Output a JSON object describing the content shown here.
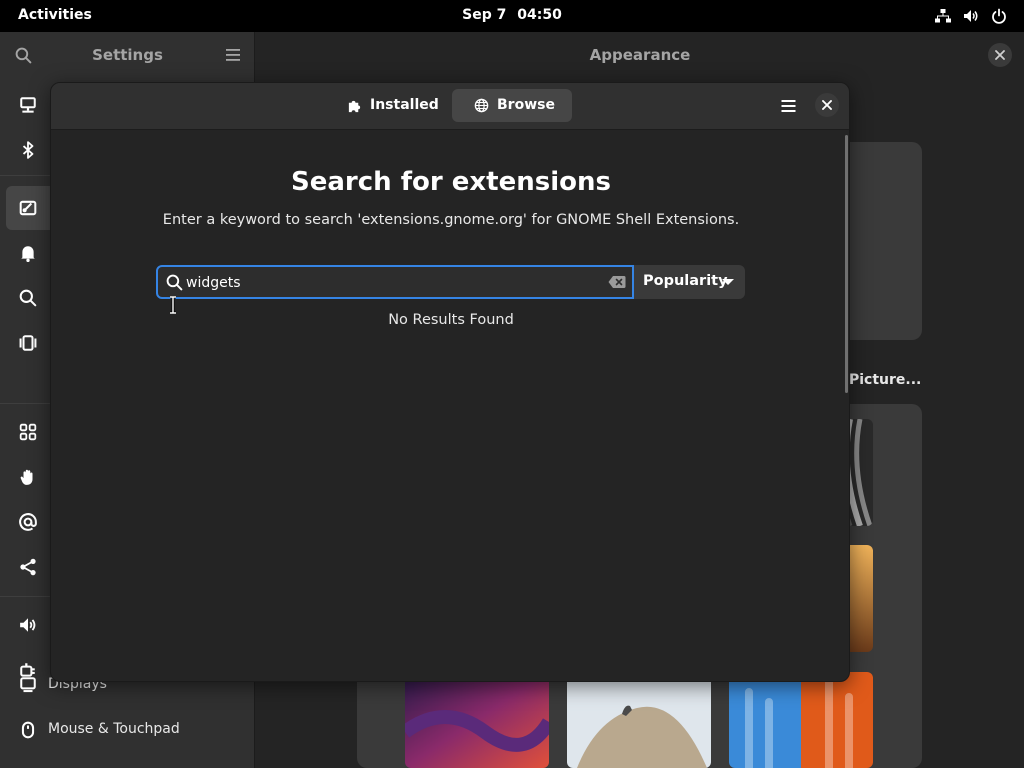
{
  "topbar": {
    "activities": "Activities",
    "date": "Sep 7",
    "time": "04:50",
    "tray_icons": [
      "network-icon",
      "volume-icon",
      "power-icon"
    ]
  },
  "settings": {
    "sidebar_title": "Settings",
    "main_title": "Appearance",
    "sidebar_items": [
      {
        "icon": "network-computer-icon",
        "label": ""
      },
      {
        "icon": "bluetooth-icon",
        "label": ""
      },
      {
        "icon": "appearance-icon",
        "label": "",
        "active": true
      },
      {
        "icon": "bell-icon",
        "label": ""
      },
      {
        "icon": "search-icon",
        "label": ""
      },
      {
        "icon": "multitasking-icon",
        "label": ""
      },
      {
        "icon": "apps-grid-icon",
        "label": ""
      },
      {
        "icon": "hand-icon",
        "label": ""
      },
      {
        "icon": "at-icon",
        "label": ""
      },
      {
        "icon": "share-icon",
        "label": ""
      },
      {
        "icon": "sound-icon",
        "label": ""
      },
      {
        "icon": "power-plug-icon",
        "label": ""
      },
      {
        "icon": "display-icon",
        "label": "Displays"
      },
      {
        "icon": "mouse-icon",
        "label": "Mouse & Touchpad"
      }
    ],
    "background_label": "Picture..."
  },
  "dialog": {
    "tabs": [
      {
        "label": "Installed",
        "icon": "puzzle-icon"
      },
      {
        "label": "Browse",
        "icon": "globe-icon",
        "selected": true
      }
    ],
    "title": "Search for extensions",
    "description": "Enter a keyword to search 'extensions.gnome.org' for GNOME Shell Extensions.",
    "search": {
      "value": "widgets",
      "placeholder": ""
    },
    "sort": {
      "selected": "Popularity"
    },
    "status": "No Results Found"
  },
  "colors": {
    "accent": "#3584e4",
    "window_bg": "#242424",
    "sidebar_bg": "#303030",
    "selected_bg": "#464646"
  }
}
